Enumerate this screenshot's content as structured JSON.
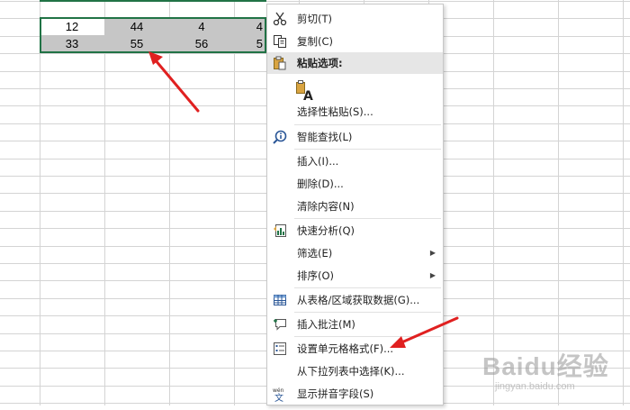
{
  "sheet": {
    "rows": [
      [
        "12",
        "44",
        "4",
        "4"
      ],
      [
        "33",
        "55",
        "56",
        "5"
      ]
    ]
  },
  "menu": {
    "cut": "剪切(T)",
    "copy": "复制(C)",
    "paste_header": "粘贴选项:",
    "paste_special": "选择性粘贴(S)...",
    "smart_lookup": "智能查找(L)",
    "insert": "插入(I)...",
    "delete": "删除(D)...",
    "clear": "清除内容(N)",
    "quick_analysis": "快速分析(Q)",
    "filter": "筛选(E)",
    "sort": "排序(O)",
    "get_data": "从表格/区域获取数据(G)...",
    "insert_comment": "插入批注(M)",
    "format_cells": "设置单元格格式(F)...",
    "pick_list": "从下拉列表中选择(K)...",
    "phonetic": "显示拼音字段(S)",
    "submenu_arrow": "▶",
    "paste_icon_letter": "A",
    "phonetic_icon_top": "wén",
    "phonetic_icon_bottom": "文"
  },
  "watermark": {
    "brand": "Baidu经验",
    "url": "jingyan.baidu.com"
  },
  "colors": {
    "selection_border": "#217346",
    "selected_fill": "#c6c6c6",
    "menu_header_bg": "#e6e6e6",
    "arrow": "#e02020",
    "grid_line": "#d4d4d4"
  }
}
